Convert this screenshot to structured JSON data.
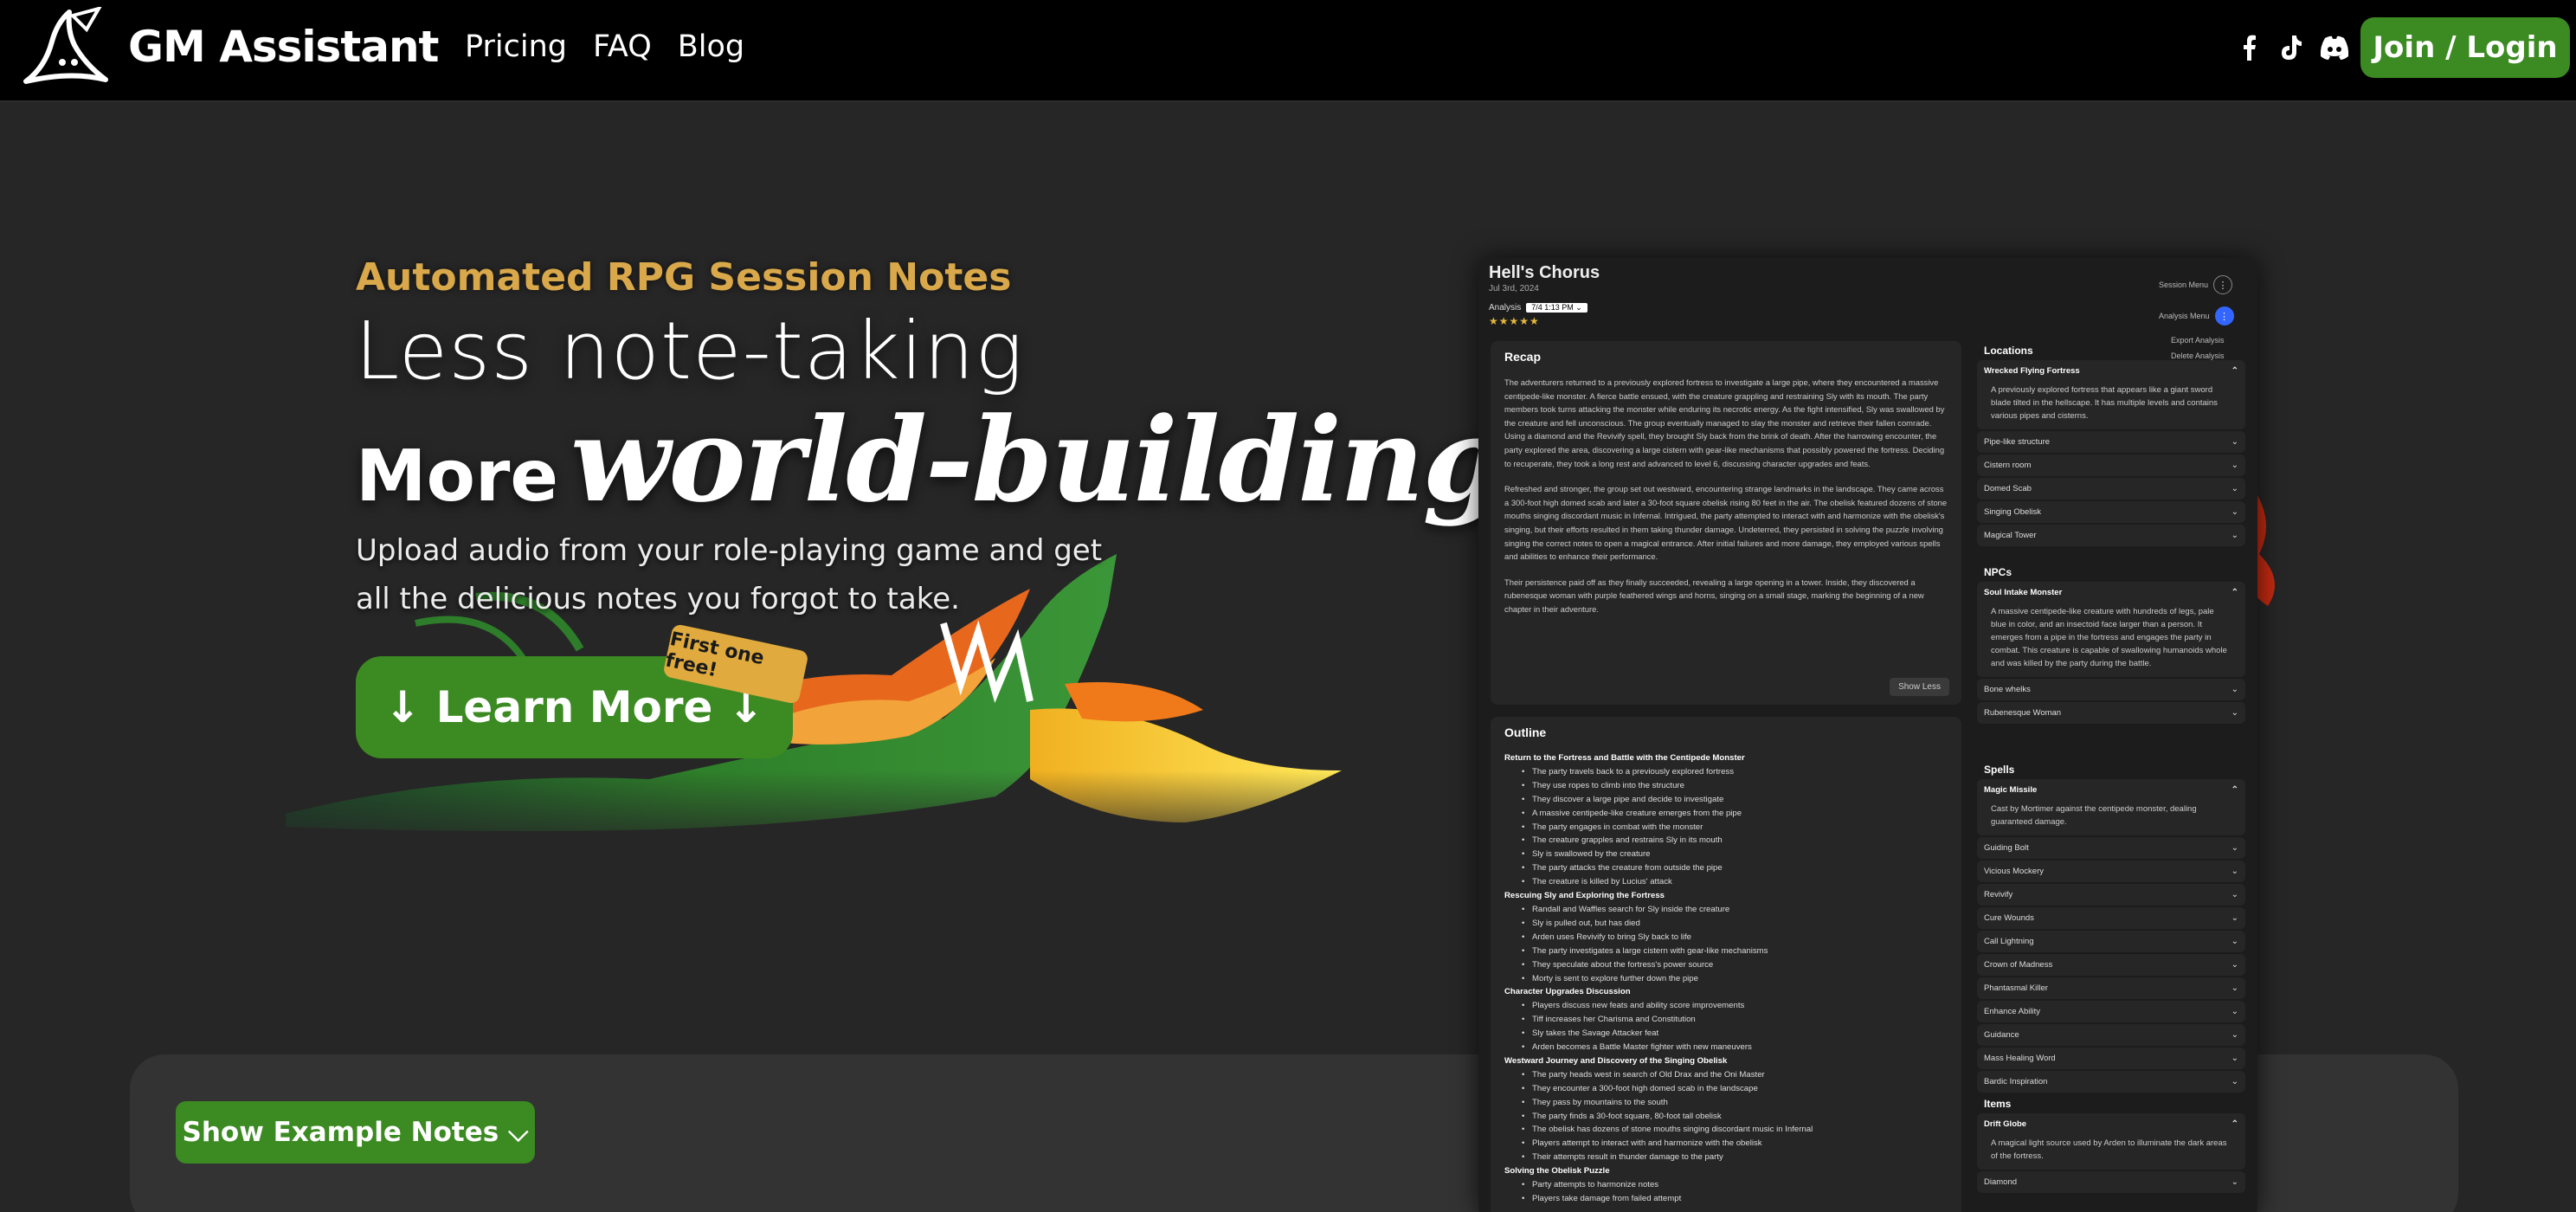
{
  "nav": {
    "brand": "GM Assistant",
    "links": [
      "Pricing",
      "FAQ",
      "Blog"
    ],
    "join_label": "Join / Login"
  },
  "hero": {
    "eyebrow": "Automated RPG Session Notes",
    "line1": "Less note-taking",
    "line2a": "More",
    "line2b": "world-building",
    "subtext": "Upload audio from your role-playing game and get all the delicious notes you forgot to take.",
    "learn_label": "↓ Learn More ↓",
    "badge": "First one free!",
    "example_label": "Show Example Notes ⌵"
  },
  "app": {
    "title": "Hell's Chorus",
    "date": "Jul 3rd, 2024",
    "analysis_label": "Analysis",
    "analysis_value": "7/4 1:13 PM ⌄",
    "stars": "★★★★★",
    "session_menu": "Session Menu",
    "analysis_menu": "Analysis Menu",
    "menu_items": [
      "Export Analysis",
      "Delete Analysis"
    ],
    "recap_title": "Recap",
    "recap_paragraphs": [
      "The adventurers returned to a previously explored fortress to investigate a large pipe, where they encountered a massive centipede-like monster. A fierce battle ensued, with the creature grappling and restraining Sly with its mouth. The party members took turns attacking the monster while enduring its necrotic energy. As the fight intensified, Sly was swallowed by the creature and fell unconscious. The group eventually managed to slay the monster and retrieve their fallen comrade. Using a diamond and the Revivify spell, they brought Sly back from the brink of death. After the harrowing encounter, the party explored the area, discovering a large cistern with gear-like mechanisms that possibly powered the fortress. Deciding to recuperate, they took a long rest and advanced to level 6, discussing character upgrades and feats.",
      "Refreshed and stronger, the group set out westward, encountering strange landmarks in the landscape. They came across a 300-foot high domed scab and later a 30-foot square obelisk rising 80 feet in the air. The obelisk featured dozens of stone mouths singing discordant music in Infernal. Intrigued, the party attempted to interact with and harmonize with the obelisk's singing, but their efforts resulted in them taking thunder damage. Undeterred, they persisted in solving the puzzle involving singing the correct notes to open a magical entrance. After initial failures and more damage, they employed various spells and abilities to enhance their performance.",
      "Their persistence paid off as they finally succeeded, revealing a large opening in a tower. Inside, they discovered a rubenesque woman with purple feathered wings and horns, singing on a small stage, marking the beginning of a new chapter in their adventure."
    ],
    "show_less": "Show Less",
    "outline_title": "Outline",
    "outline": [
      {
        "head": "Return to the Fortress and Battle with the Centipede Monster",
        "items": [
          "The party travels back to a previously explored fortress",
          "They use ropes to climb into the structure",
          "They discover a large pipe and decide to investigate",
          "A massive centipede-like creature emerges from the pipe",
          "The party engages in combat with the monster",
          "The creature grapples and restrains Sly in its mouth",
          "Sly is swallowed by the creature",
          "The party attacks the creature from outside the pipe",
          "The creature is killed by Lucius' attack"
        ]
      },
      {
        "head": "Rescuing Sly and Exploring the Fortress",
        "items": [
          "Randall and Waffles search for Sly inside the creature",
          "Sly is pulled out, but has died",
          "Arden uses Revivify to bring Sly back to life",
          "The party investigates a large cistern with gear-like mechanisms",
          "They speculate about the fortress's power source",
          "Morty is sent to explore further down the pipe"
        ]
      },
      {
        "head": "Character Upgrades Discussion",
        "items": [
          "Players discuss new feats and ability score improvements",
          "Tiff increases her Charisma and Constitution",
          "Sly takes the Savage Attacker feat",
          "Arden becomes a Battle Master fighter with new maneuvers"
        ]
      },
      {
        "head": "Westward Journey and Discovery of the Singing Obelisk",
        "items": [
          "The party heads west in search of Old Drax and the Oni Master",
          "They encounter a 300-foot high domed scab in the landscape",
          "They pass by mountains to the south",
          "The party finds a 30-foot square, 80-foot tall obelisk",
          "The obelisk has dozens of stone mouths singing discordant music in Infernal",
          "Players attempt to interact with and harmonize with the obelisk",
          "Their attempts result in thunder damage to the party"
        ]
      },
      {
        "head": "Solving the Obelisk Puzzle",
        "items": [
          "Party attempts to harmonize notes",
          "Players take damage from failed attempt"
        ]
      }
    ],
    "locations_title": "Locations",
    "locations_open": "Wrecked Flying Fortress",
    "locations_open_desc": "A previously explored fortress that appears like a giant sword blade tilted in the hellscape. It has multiple levels and contains various pipes and cisterns.",
    "locations": [
      "Pipe-like structure",
      "Cistern room",
      "Domed Scab",
      "Singing Obelisk",
      "Magical Tower"
    ],
    "npcs_title": "NPCs",
    "npcs_open": "Soul Intake Monster",
    "npcs_open_desc": "A massive centipede-like creature with hundreds of legs, pale blue in color, and an insectoid face larger than a person. It emerges from a pipe in the fortress and engages the party in combat. This creature is capable of swallowing humanoids whole and was killed by the party during the battle.",
    "npcs": [
      "Bone whelks",
      "Rubenesque Woman"
    ],
    "spells_title": "Spells",
    "spells_open": "Magic Missile",
    "spells_open_desc": "Cast by Mortimer against the centipede monster, dealing guaranteed damage.",
    "spells": [
      "Guiding Bolt",
      "Vicious Mockery",
      "Revivify",
      "Cure Wounds",
      "Call Lightning",
      "Crown of Madness",
      "Phantasmal Killer",
      "Enhance Ability",
      "Guidance",
      "Mass Healing Word",
      "Bardic Inspiration"
    ],
    "items_title": "Items",
    "items_open": "Drift Globe",
    "items_open_desc": "A magical light source used by Arden to illuminate the dark areas of the fortress.",
    "items": [
      "Diamond"
    ]
  }
}
